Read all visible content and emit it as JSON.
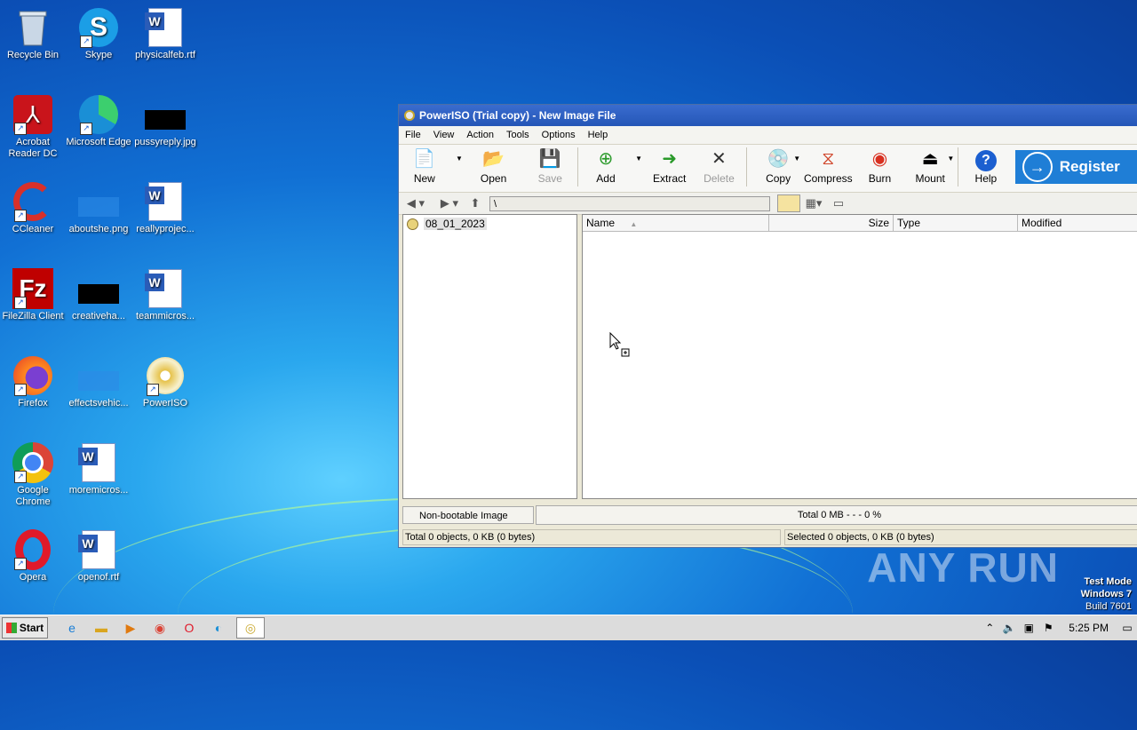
{
  "desktop": {
    "icons": [
      {
        "label": "Recycle Bin"
      },
      {
        "label": "Skype"
      },
      {
        "label": "physicalfeb.rtf"
      },
      {
        "label": "Acrobat Reader DC"
      },
      {
        "label": "Microsoft Edge"
      },
      {
        "label": "pussyreply.jpg"
      },
      {
        "label": "CCleaner"
      },
      {
        "label": "aboutshe.png"
      },
      {
        "label": "reallyprojec..."
      },
      {
        "label": "FileZilla Client"
      },
      {
        "label": "creativeha..."
      },
      {
        "label": "teammicros..."
      },
      {
        "label": "Firefox"
      },
      {
        "label": "effectsvehic..."
      },
      {
        "label": "PowerISO"
      },
      {
        "label": "Google Chrome"
      },
      {
        "label": "moremicros..."
      },
      {
        "label": "Opera"
      },
      {
        "label": "openof.rtf"
      }
    ],
    "watermark": "ANY RUN",
    "test_mode": {
      "line1": "Test Mode",
      "line2": "Windows 7",
      "line3": "Build 7601"
    }
  },
  "window": {
    "title": "PowerISO (Trial copy) - New Image File",
    "menu": [
      "File",
      "View",
      "Action",
      "Tools",
      "Options",
      "Help"
    ],
    "toolbar": {
      "new": "New",
      "open": "Open",
      "save": "Save",
      "add": "Add",
      "extract": "Extract",
      "delete": "Delete",
      "copy": "Copy",
      "compress": "Compress",
      "burn": "Burn",
      "mount": "Mount",
      "help": "Help",
      "register": "Register"
    },
    "path": "\\",
    "tree": {
      "root": "08_01_2023"
    },
    "columns": {
      "name": "Name",
      "size": "Size",
      "type": "Type",
      "modified": "Modified"
    },
    "status": {
      "boot": "Non-bootable Image",
      "total": "Total  0 MB   - - -  0 %",
      "left": "Total 0 objects, 0 KB (0 bytes)",
      "right": "Selected 0 objects, 0 KB (0 bytes)"
    }
  },
  "taskbar": {
    "start": "Start",
    "clock": "5:25 PM"
  },
  "colors": {
    "title_bar": "#2456b7",
    "register_button": "#1f7ed6"
  }
}
